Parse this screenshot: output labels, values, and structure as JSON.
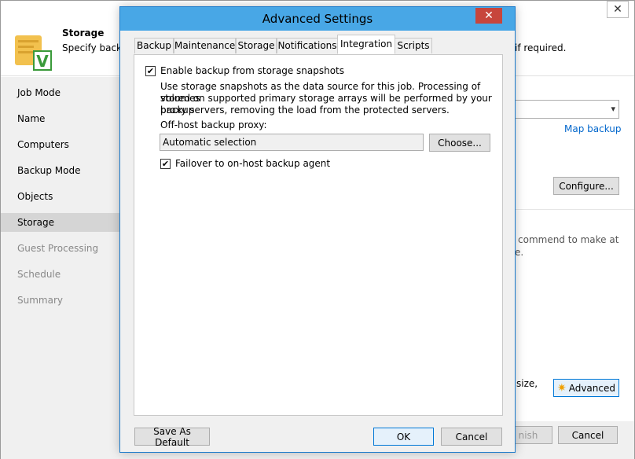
{
  "background": {
    "header": {
      "title": "Storage",
      "description": "Specify backu",
      "description_tail": "if required."
    },
    "nav": [
      {
        "label": "Job Mode",
        "state": "normal"
      },
      {
        "label": "Name",
        "state": "normal"
      },
      {
        "label": "Computers",
        "state": "normal"
      },
      {
        "label": "Backup Mode",
        "state": "normal"
      },
      {
        "label": "Objects",
        "state": "normal"
      },
      {
        "label": "Storage",
        "state": "active"
      },
      {
        "label": "Guest Processing",
        "state": "dim"
      },
      {
        "label": "Schedule",
        "state": "dim"
      },
      {
        "label": "Summary",
        "state": "dim"
      }
    ],
    "map_backup_link": "Map backup",
    "configure_button": "Configure...",
    "recommend_text_1": "commend to make at",
    "recommend_text_2": "e.",
    "size_text": "size,",
    "advanced_button": "Advanced",
    "finish_button": "nish",
    "cancel_button": "Cancel"
  },
  "dialog": {
    "title": "Advanced Settings",
    "tabs": [
      {
        "label": "Backup",
        "active": false
      },
      {
        "label": "Maintenance",
        "active": false
      },
      {
        "label": "Storage",
        "active": false
      },
      {
        "label": "Notifications",
        "active": false
      },
      {
        "label": "Integration",
        "active": true
      },
      {
        "label": "Scripts",
        "active": false
      }
    ],
    "integration": {
      "enable_snapshots_label": "Enable backup from storage snapshots",
      "enable_snapshots_checked": true,
      "description_lines": [
        "Use storage snapshots as the data source for this job. Processing of volumes",
        "stored on supported primary storage arrays will be performed by your backup",
        "proxy servers, removing the load from the protected servers."
      ],
      "proxy_label": "Off-host backup proxy:",
      "proxy_value": "Automatic selection",
      "choose_button": "Choose...",
      "failover_label": "Failover to on-host backup agent",
      "failover_checked": true
    },
    "footer": {
      "save_default_button": "Save As Default",
      "ok_button": "OK",
      "cancel_button": "Cancel"
    }
  },
  "colors": {
    "dialog_title_bar": "#48a7e6",
    "dialog_close": "#c7453c",
    "link": "#0066cc",
    "nav_background": "#f0f0f0",
    "nav_active": "#d5d5d5"
  }
}
